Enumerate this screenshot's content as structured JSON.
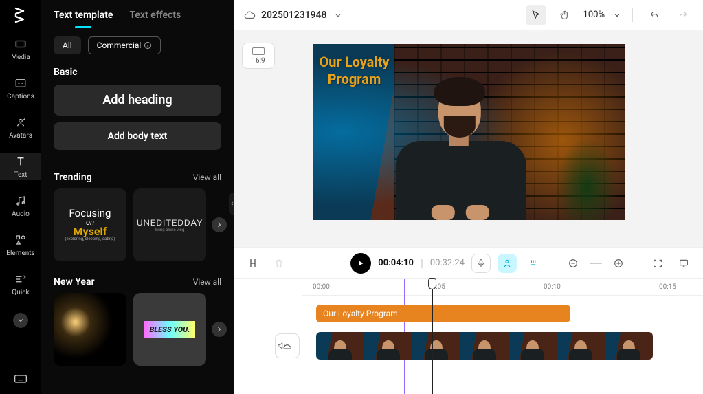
{
  "rail": {
    "items": [
      {
        "label": "Media"
      },
      {
        "label": "Captions"
      },
      {
        "label": "Avatars"
      },
      {
        "label": "Text"
      },
      {
        "label": "Audio"
      },
      {
        "label": "Elements"
      },
      {
        "label": "Quick"
      }
    ]
  },
  "panel": {
    "tabs": {
      "template": "Text template",
      "effects": "Text effects"
    },
    "filters": {
      "all": "All",
      "commercial": "Commercial"
    },
    "basic": {
      "title": "Basic",
      "heading_btn": "Add heading",
      "body_btn": "Add body text"
    },
    "trending": {
      "title": "Trending",
      "viewall": "View all",
      "card1": {
        "l1": "Focusing",
        "l2": "on",
        "l3": "Myself",
        "l4": "(exploring, sleeping, eating)"
      },
      "card2": {
        "l1": "UNEDITEDDAY",
        "l2": "living alone vlog"
      }
    },
    "newyear": {
      "title": "New Year",
      "viewall": "View all",
      "bless": "BLESS YOU."
    }
  },
  "topbar": {
    "project": "202501231948",
    "zoom": "100%"
  },
  "preview": {
    "ratio": "16:9",
    "overlay": {
      "l1": "Our Loyalty",
      "l2": "Program"
    }
  },
  "controls": {
    "cur": "00:04:10",
    "tot": "00:32:24"
  },
  "timeline": {
    "marks": [
      "00:00",
      "00:05",
      "00:10",
      "00:15"
    ],
    "text_clip": "Our Loyalty Program"
  }
}
